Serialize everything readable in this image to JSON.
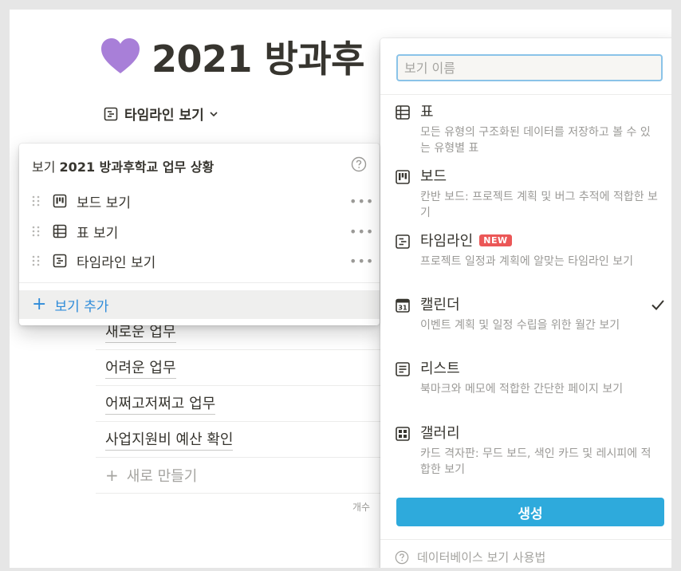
{
  "page": {
    "title": "2021 방과후",
    "view_switch": "타임라인 보기",
    "rows": [
      "새로운 업무",
      "어려운 업무",
      "어쩌고저쩌고 업무",
      "사업지원비 예산 확인"
    ],
    "new_row": "새로 만들기",
    "count_label": "개수"
  },
  "views_panel": {
    "header_prefix": "보기",
    "header_db": "2021 방과후학교 업무 상황",
    "items": [
      {
        "label": "보드 보기",
        "icon": "board-icon"
      },
      {
        "label": "표 보기",
        "icon": "table-icon"
      },
      {
        "label": "타임라인 보기",
        "icon": "timeline-icon"
      }
    ],
    "more": "•••",
    "add_label": "보기 추가"
  },
  "dropdown": {
    "name_placeholder": "보기 이름",
    "options": [
      {
        "name": "표",
        "desc": "모든 유형의 구조화된 데이터를 저장하고 볼 수 있는 유형별 표",
        "icon": "table-icon"
      },
      {
        "name": "보드",
        "desc": "칸반 보드: 프로젝트 계획 및 버그 추적에 적합한 보기",
        "icon": "board-icon"
      },
      {
        "name": "타임라인",
        "badge": "NEW",
        "desc": "프로젝트 일정과 계획에 알맞는 타임라인 보기",
        "icon": "timeline-icon"
      },
      {
        "name": "캘린더",
        "desc": "이벤트 계획 및 일정 수립을 위한 월간 보기",
        "icon": "calendar-icon",
        "calendar_day": "31",
        "selected": true
      },
      {
        "name": "리스트",
        "desc": "북마크와 메모에 적합한 간단한 페이지 보기",
        "icon": "list-icon"
      },
      {
        "name": "갤러리",
        "desc": "카드 격자판: 무드 보드, 색인 카드 및 레시피에 적합한 보기",
        "icon": "gallery-icon"
      }
    ],
    "create_label": "생성",
    "help_label": "데이터베이스 보기 사용법"
  },
  "colors": {
    "accent_blue": "#2eaadc",
    "link_blue": "#2e8bd9",
    "badge_red": "#eb5757",
    "heart_purple": "#a87fd8",
    "text": "#37352f",
    "muted": "#9b9a97"
  }
}
